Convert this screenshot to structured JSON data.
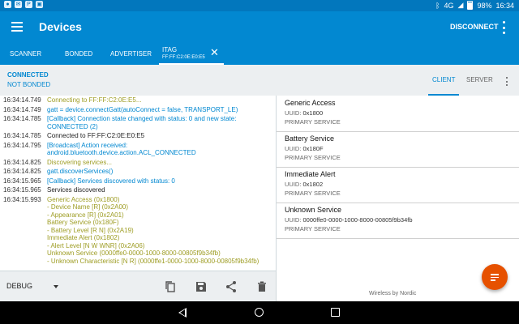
{
  "status_bar": {
    "time": "16:34",
    "network": "4G",
    "battery": "98%",
    "left_icons": [
      "app-notification-icon",
      "email-icon",
      "pinterest-icon",
      "image-icon"
    ],
    "right_icons": [
      "bluetooth-icon",
      "signal-icon",
      "battery-icon"
    ]
  },
  "toolbar": {
    "title": "Devices",
    "disconnect_label": "DISCONNECT"
  },
  "tabs": [
    {
      "label": "SCANNER"
    },
    {
      "label": "BONDED"
    },
    {
      "label": "ADVERTISER"
    },
    {
      "label": "ITAG",
      "sub": "FF:FF:C2:0E:E0:E5"
    }
  ],
  "connection": {
    "state": "CONNECTED",
    "bond": "NOT BONDED"
  },
  "subtabs": {
    "client": "CLIENT",
    "server": "SERVER"
  },
  "log": [
    {
      "time": "16:34:14.749",
      "msg": "Connecting to FF:FF:C2:0E:E5...",
      "level": "verbose"
    },
    {
      "time": "16:34:14.749",
      "msg": "gatt = device.connectGatt(autoConnect = false, TRANSPORT_LE)",
      "level": "debug_blue"
    },
    {
      "time": "16:34:14.785",
      "msg": "[Callback] Connection state changed with status: 0 and new state: CONNECTED (2)",
      "level": "info"
    },
    {
      "time": "16:34:14.785",
      "msg": "Connected to FF:FF:C2:0E:E0:E5",
      "level": "debug"
    },
    {
      "time": "16:34:14.795",
      "msg": "[Broadcast] Action received: android.bluetooth.device.action.ACL_CONNECTED",
      "level": "info"
    },
    {
      "time": "16:34:14.825",
      "msg": "Discovering services...",
      "level": "verbose"
    },
    {
      "time": "16:34:14.825",
      "msg": "gatt.discoverServices()",
      "level": "info"
    },
    {
      "time": "16:34:15.965",
      "msg": "[Callback] Services discovered with status: 0",
      "level": "info"
    },
    {
      "time": "16:34:15.965",
      "msg": "Services discovered",
      "level": "debug"
    },
    {
      "time": "16:34:15.993",
      "msg": "Generic Access (0x1800)\n- Device Name [R] (0x2A00)\n- Appearance [R] (0x2A01)\nBattery Service (0x180F)\n- Battery Level [R N] (0x2A19)\nImmediate Alert (0x1802)\n- Alert Level [N W WNR] (0x2A06)\nUnknown Service (0000ffe0-0000-1000-8000-00805f9b34fb)\n- Unknown Characteristic [N R] (0000ffe1-0000-1000-8000-00805f9b34fb)",
      "level": "app"
    }
  ],
  "log_level": "DEBUG",
  "services": [
    {
      "name": "Generic Access",
      "uuid_label": "UUID:",
      "uuid": "0x1800",
      "type": "PRIMARY SERVICE"
    },
    {
      "name": "Battery Service",
      "uuid_label": "UUID:",
      "uuid": "0x180F",
      "type": "PRIMARY SERVICE"
    },
    {
      "name": "Immediate Alert",
      "uuid_label": "UUID:",
      "uuid": "0x1802",
      "type": "PRIMARY SERVICE"
    },
    {
      "name": "Unknown Service",
      "uuid_label": "UUID:",
      "uuid": "0000ffe0-0000-1000-8000-00805f9b34fb",
      "type": "PRIMARY SERVICE"
    }
  ],
  "footer": "Wireless by Nordic",
  "colors": {
    "primary": "#0288d1",
    "status_bar": "#0277bd",
    "fab": "#e65100",
    "log_app": "#9e9d24"
  }
}
